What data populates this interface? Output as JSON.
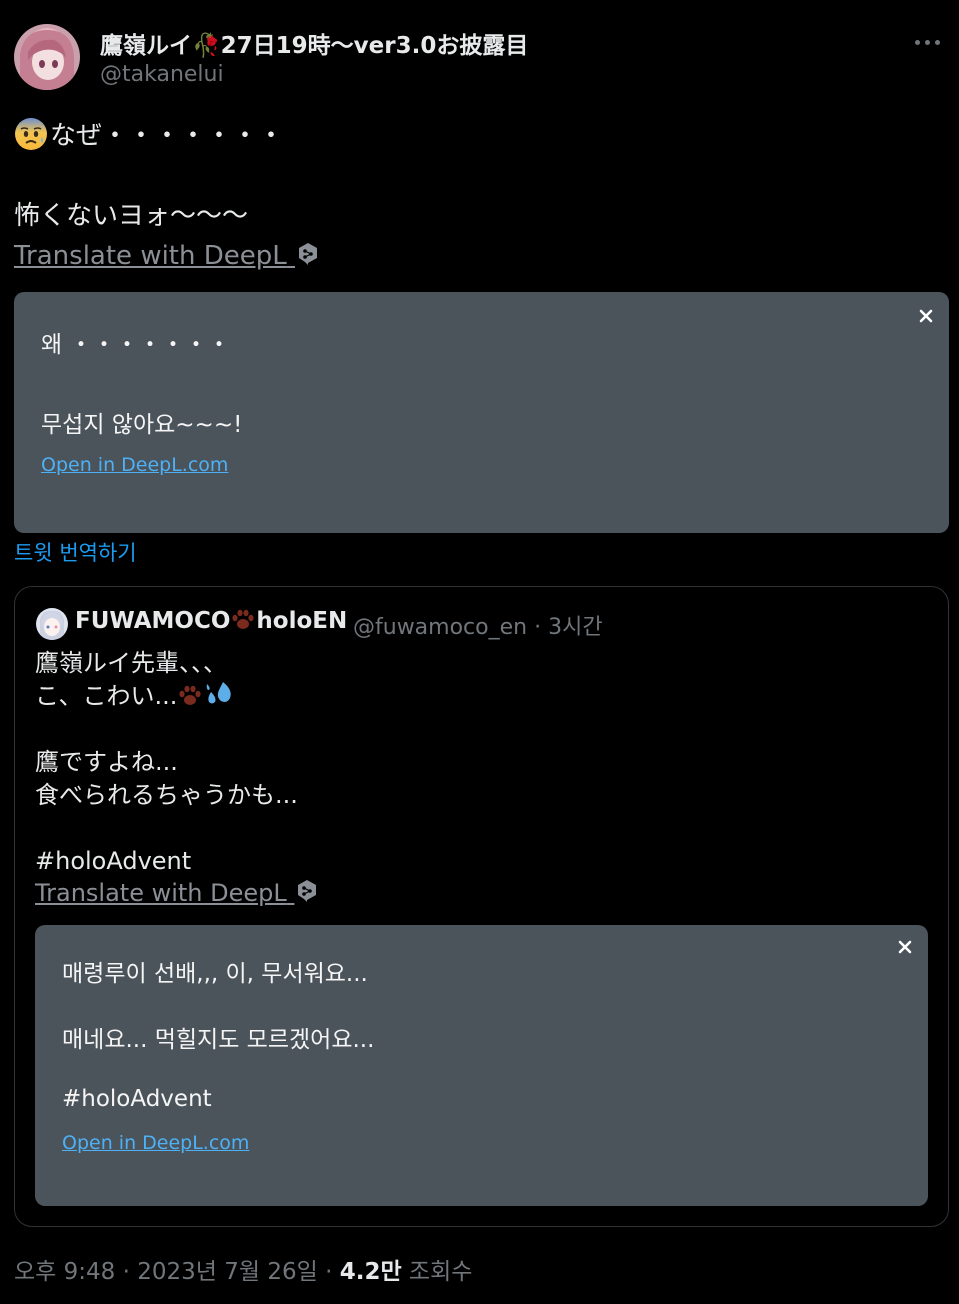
{
  "author": {
    "display_name": "鷹嶺ルイ🥀27日19時～ver3.0お披露目",
    "handle": "@takanelui"
  },
  "tweet": {
    "line1": "なぜ・・・・・・・",
    "line2": "怖くないヨォ～～～",
    "deepl_link": "Translate with DeepL"
  },
  "translation": {
    "line1": "왜 ・・・・・・・",
    "line2": "무섭지 않아요~~~!",
    "open_link": "Open in DeepL.com"
  },
  "translate_tweet_label": "트윗 번역하기",
  "quote": {
    "name": "FUWAMOCO",
    "name_suffix": "holoEN",
    "handle": "@fuwamoco_en",
    "time": "3시간",
    "line1": "鷹嶺ルイ先輩、、、",
    "line2": "こ、こわい...",
    "line3": "鷹ですよね...",
    "line4": "食べられるちゃうかも...",
    "hashtag": "#holoAdvent",
    "deepl_link": "Translate with DeepL",
    "translation": {
      "line1": "매령루이 선배,,, 이, 무서워요...",
      "line2": "매네요... 먹힐지도 모르겠어요...",
      "line3": "#holoAdvent",
      "open_link": "Open in DeepL.com"
    }
  },
  "footer": {
    "time": "오후 9:48",
    "date": "2023년 7월 26일",
    "views_count": "4.2만",
    "views_label": "조회수"
  },
  "colors": {
    "background": "#000000",
    "text": "#e7e9ea",
    "muted": "#71767b",
    "link_blue": "#1d9bf0",
    "translation_box": "#4b535b"
  }
}
